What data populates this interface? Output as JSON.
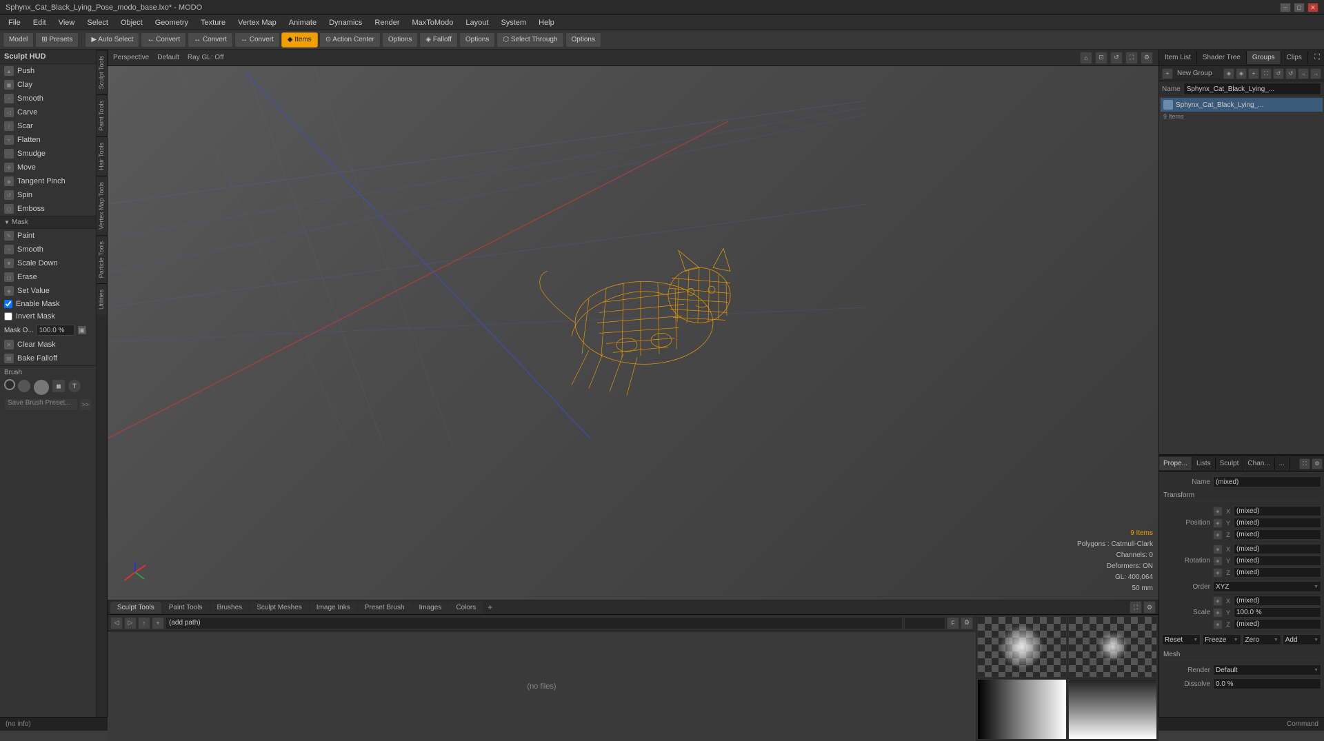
{
  "app": {
    "title": "Sphynx_Cat_Black_Lying_Pose_modo_base.lxo* - MODO",
    "window_controls": {
      "minimize": "─",
      "maximize": "□",
      "close": "✕"
    }
  },
  "menu": {
    "items": [
      "File",
      "Edit",
      "View",
      "Select",
      "Object",
      "Geometry",
      "Texture",
      "Vertex Map",
      "Animate",
      "Dynamics",
      "Render",
      "MaxToModo",
      "Layout",
      "System",
      "Help"
    ]
  },
  "toolbar": {
    "model_label": "Model",
    "presets_label": "⊞ Presets",
    "auto_select_label": "▶ Auto Select",
    "convert1_label": "↔ Convert",
    "convert2_label": "↔ Convert",
    "convert3_label": "↔ Convert",
    "items_label": "◆ Items",
    "action_center_label": "⊙ Action Center",
    "options1_label": "Options",
    "falloff_label": "◈ Falloff",
    "options2_label": "Options",
    "select_through_label": "⬡ Select Through",
    "options3_label": "Options"
  },
  "viewport": {
    "view_mode": "Perspective",
    "display_mode": "Default",
    "ray_gl": "Ray GL: Off"
  },
  "left_panel": {
    "title": "Sculpt HUD",
    "tools": [
      {
        "name": "Push",
        "icon": "▲"
      },
      {
        "name": "Clay",
        "icon": "◼"
      },
      {
        "name": "Smooth",
        "icon": "~"
      },
      {
        "name": "Carve",
        "icon": "◁"
      },
      {
        "name": "Scar",
        "icon": "/"
      },
      {
        "name": "Flatten",
        "icon": "="
      },
      {
        "name": "Smudge",
        "icon": "◌"
      },
      {
        "name": "Move",
        "icon": "✛"
      },
      {
        "name": "Tangent Pinch",
        "icon": "◈"
      },
      {
        "name": "Spin",
        "icon": "↺"
      },
      {
        "name": "Emboss",
        "icon": "⬡"
      }
    ],
    "mask_section": {
      "title": "Mask",
      "items": [
        {
          "name": "Paint",
          "icon": "✎"
        },
        {
          "name": "Smooth",
          "icon": "~"
        },
        {
          "name": "Scale Down",
          "icon": "▼"
        }
      ],
      "erase_label": "Erase",
      "set_value_label": "Set Value",
      "enable_mask_label": "Enable Mask",
      "invert_mask_label": "Invert Mask",
      "mask_opacity_label": "Mask O...",
      "mask_opacity_value": "100.0 %",
      "clear_mask_label": "Clear Mask",
      "bake_falloff_label": "Bake Falloff"
    },
    "brush_section": {
      "title": "Brush",
      "save_preset_label": "Save Brush Preset...",
      "more_label": ">>"
    }
  },
  "vertical_tabs": [
    "Sculpt Tools",
    "Paint Tools",
    "Hair Tools",
    "Vertex Map Tools",
    "Particle Tools",
    "Utilities"
  ],
  "right_panel": {
    "tabs": [
      "Item List",
      "Shader Tree",
      "Groups",
      "Clips"
    ],
    "new_group_label": "New Group",
    "name_label": "Name",
    "group_name": "Sphynx_Cat_Black_Lying_...",
    "item_count": "9 Items"
  },
  "properties": {
    "tabs": [
      "Prope...",
      "Lists",
      "Sculpt",
      "Chan...",
      "..."
    ],
    "name_label": "Name",
    "name_value": "(mixed)",
    "transform_label": "Transform",
    "position": {
      "label": "Position",
      "x_label": "X",
      "y_label": "Y",
      "z_label": "Z",
      "x_value": "(mixed)",
      "y_value": "(mixed)",
      "z_value": "(mixed)"
    },
    "rotation": {
      "label": "Rotation",
      "x_label": "X",
      "y_label": "Y",
      "z_label": "Z",
      "x_value": "(mixed)",
      "y_value": "(mixed)",
      "z_value": "(mixed)"
    },
    "order_label": "Order",
    "order_value": "XYZ",
    "scale": {
      "label": "Scale",
      "x_label": "X",
      "y_label": "Y",
      "z_label": "Z",
      "x_value": "(mixed)",
      "y_value": "100.0 %",
      "z_value": "(mixed)"
    },
    "actions": [
      "Reset",
      "Freeze",
      "Zero",
      "Add"
    ],
    "mesh_label": "Mesh",
    "render_label": "Render",
    "render_value": "Default",
    "dissolve_label": "Dissolve",
    "dissolve_value": "0.0 %"
  },
  "vp_info": {
    "items_count": "9 Items",
    "polygons_label": "Polygons :",
    "polygons_value": "Catmull-Clark",
    "channels_label": "Channels: 0",
    "deformers_label": "Deformers: ON",
    "gl_label": "GL: 400,064",
    "focal_length": "50 mm"
  },
  "bottom_panel": {
    "tabs": [
      "Sculpt Tools",
      "Paint Tools",
      "Brushes",
      "Sculpt Meshes",
      "Image Inks",
      "Preset Brush",
      "Images",
      "Colors"
    ],
    "no_files_label": "(no files)",
    "add_path_placeholder": "(add path)"
  },
  "status_bar": {
    "info": "(no info)",
    "command_label": "Command"
  }
}
